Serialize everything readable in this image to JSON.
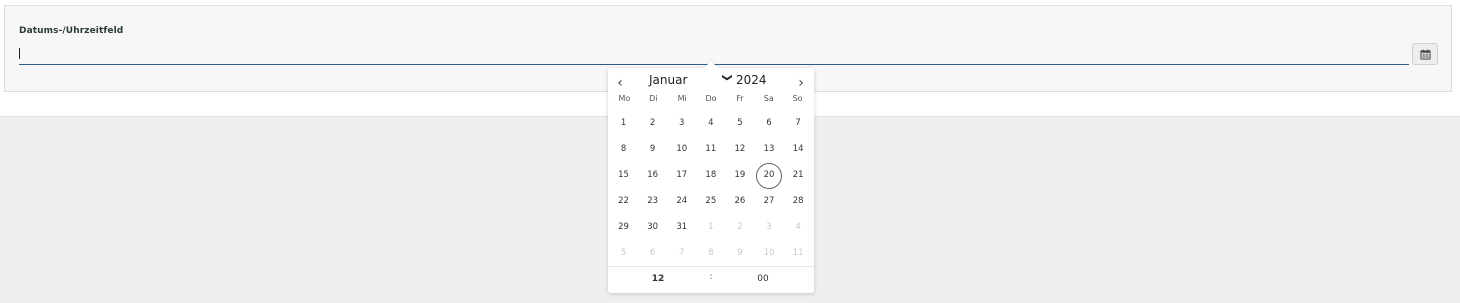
{
  "field": {
    "label": "Datums-/Uhrzeitfeld",
    "value": "",
    "calendar_icon": "calendar-icon"
  },
  "picker": {
    "prev_icon": "chevron-left-icon",
    "next_icon": "chevron-right-icon",
    "month": "Januar",
    "year": "2024",
    "weekdays": [
      "Mo",
      "Di",
      "Mi",
      "Do",
      "Fr",
      "Sa",
      "So"
    ],
    "days": [
      {
        "d": "1",
        "m": false
      },
      {
        "d": "2",
        "m": false
      },
      {
        "d": "3",
        "m": false
      },
      {
        "d": "4",
        "m": false
      },
      {
        "d": "5",
        "m": false
      },
      {
        "d": "6",
        "m": false
      },
      {
        "d": "7",
        "m": false
      },
      {
        "d": "8",
        "m": false
      },
      {
        "d": "9",
        "m": false
      },
      {
        "d": "10",
        "m": false
      },
      {
        "d": "11",
        "m": false
      },
      {
        "d": "12",
        "m": false
      },
      {
        "d": "13",
        "m": false
      },
      {
        "d": "14",
        "m": false
      },
      {
        "d": "15",
        "m": false
      },
      {
        "d": "16",
        "m": false
      },
      {
        "d": "17",
        "m": false
      },
      {
        "d": "18",
        "m": false
      },
      {
        "d": "19",
        "m": false
      },
      {
        "d": "20",
        "m": false,
        "today": true
      },
      {
        "d": "21",
        "m": false
      },
      {
        "d": "22",
        "m": false
      },
      {
        "d": "23",
        "m": false
      },
      {
        "d": "24",
        "m": false
      },
      {
        "d": "25",
        "m": false
      },
      {
        "d": "26",
        "m": false
      },
      {
        "d": "27",
        "m": false
      },
      {
        "d": "28",
        "m": false
      },
      {
        "d": "29",
        "m": false
      },
      {
        "d": "30",
        "m": false
      },
      {
        "d": "31",
        "m": false
      },
      {
        "d": "1",
        "m": true
      },
      {
        "d": "2",
        "m": true
      },
      {
        "d": "3",
        "m": true
      },
      {
        "d": "4",
        "m": true
      },
      {
        "d": "5",
        "m": true
      },
      {
        "d": "6",
        "m": true
      },
      {
        "d": "7",
        "m": true
      },
      {
        "d": "8",
        "m": true
      },
      {
        "d": "9",
        "m": true
      },
      {
        "d": "10",
        "m": true
      },
      {
        "d": "11",
        "m": true
      }
    ],
    "time": {
      "hour": "12",
      "separator": ":",
      "minute": "00"
    }
  },
  "colors": {
    "input_underline": "#2c5b86",
    "panel_bg": "#f7f7f7",
    "page_bg": "#efefef"
  }
}
